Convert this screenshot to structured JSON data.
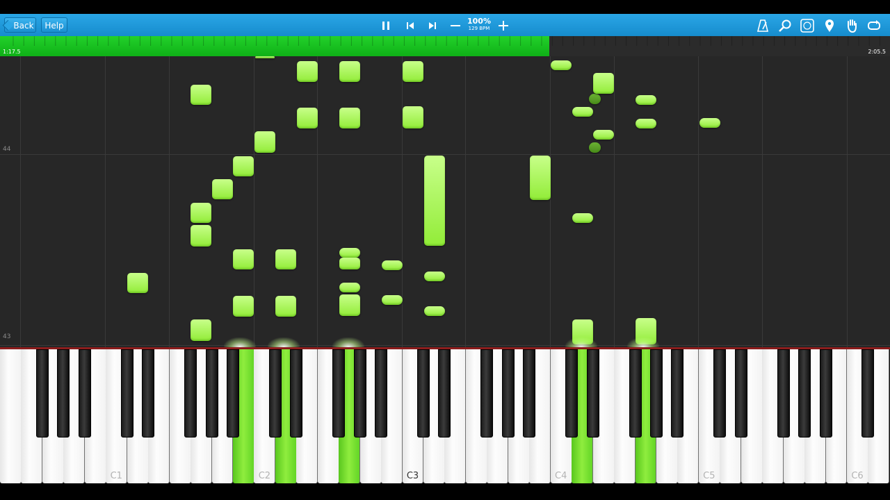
{
  "toolbar": {
    "back_label": "Back",
    "help_label": "Help",
    "speed_percent": "100%",
    "speed_bpm": "129 BPM",
    "icons": [
      "pause-icon",
      "previous-icon",
      "next-icon",
      "minus-icon",
      "plus-icon",
      "metronome-icon",
      "zoom-icon",
      "key-label-icon",
      "marker-icon",
      "hand-icon",
      "loop-icon"
    ]
  },
  "progress": {
    "current_time": "1:17.5",
    "total_time": "2:05.5",
    "fraction": 0.617
  },
  "roll": {
    "measure_labels": [
      "44",
      "43"
    ]
  },
  "keyboard": {
    "octave_labels": [
      "C1",
      "C2",
      "C3",
      "C4",
      "C5",
      "C6"
    ],
    "active_white_keys": [
      "C#2 area",
      "E2",
      "G2",
      "D4",
      "G4"
    ]
  },
  "colors": {
    "toolbar": "#1a9ad9",
    "progress_fill": "#18c020",
    "note": "#a6f24c",
    "note_dark": "#5aa028",
    "background": "#272727",
    "active_key": "#7ae233"
  }
}
